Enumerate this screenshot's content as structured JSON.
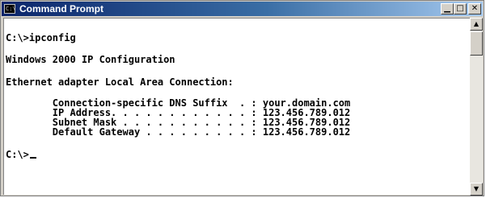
{
  "window": {
    "title": "Command Prompt",
    "icon": "console-icon",
    "icon_glyph": "C:\\",
    "controls": {
      "minimize": "▁",
      "maximize": "□",
      "close": "✕"
    }
  },
  "console": {
    "lines": [
      "C:\\>ipconfig",
      "Windows 2000 IP Configuration",
      "Ethernet adapter Local Area Connection:",
      "        Connection-specific DNS Suffix  . : your.domain.com",
      "        IP Address. . . . . . . . . . . . : 123.456.789.012",
      "        Subnet Mask . . . . . . . . . . . : 123.456.789.012",
      "        Default Gateway . . . . . . . . . : 123.456.789.012",
      "C:\\>"
    ]
  },
  "scrollbar": {
    "up_arrow": "▲",
    "down_arrow": "▼"
  },
  "colors": {
    "title_gradient_start": "#0a246a",
    "title_gradient_end": "#a6caf0",
    "console_background": "#ffffff",
    "console_text": "#000000",
    "chrome": "#d4d0c8"
  }
}
